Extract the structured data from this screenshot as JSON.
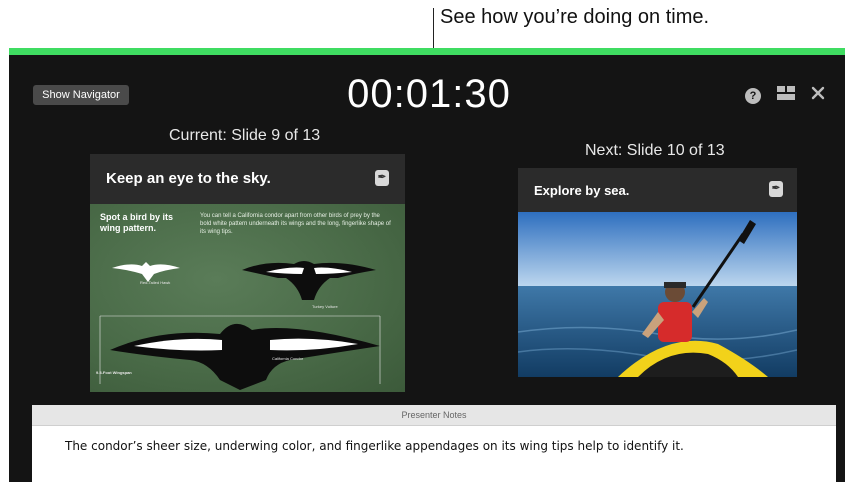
{
  "callout": {
    "text": "See how you’re doing on time."
  },
  "colors": {
    "accent_bar": "#3fdc61",
    "window_bg": "#141414",
    "slide_green": "#4a6b48"
  },
  "toolbar": {
    "show_navigator_label": "Show Navigator",
    "timer": "00:01:30",
    "help_icon_glyph": "?",
    "icons": [
      "help-icon",
      "layout-icon",
      "close-icon"
    ]
  },
  "current_slide": {
    "label": "Current: Slide 9 of 13",
    "title": "Keep an eye to the sky.",
    "subtitle": "Spot a bird by its wing pattern.",
    "paragraph": "You can tell a California condor apart from other birds of prey by the bold white pattern underneath its wings and the long, fingerlike shape of its wing tips.",
    "bird_labels": [
      "Red-Tailed Hawk",
      "Turkey Vulture",
      "California Condor"
    ],
    "wingspan_label": "9.5-Foot Wingspan"
  },
  "next_slide": {
    "label": "Next: Slide 10 of 13",
    "title": "Explore by sea."
  },
  "notes": {
    "header": "Presenter Notes",
    "text": "The condor’s sheer size, underwing color, and fingerlike appendages on its wing tips help to identify it."
  }
}
